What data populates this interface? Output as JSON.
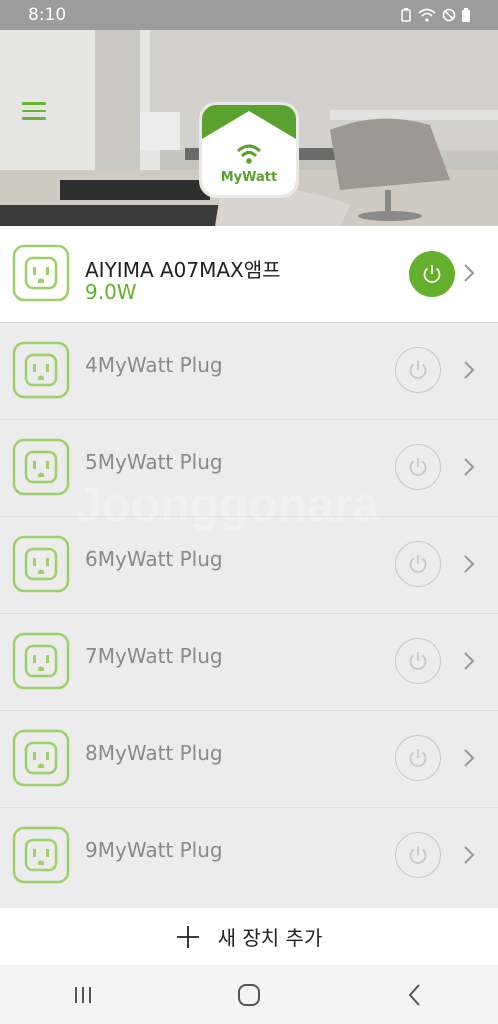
{
  "status_bar": {
    "time": "8:10"
  },
  "app": {
    "logo_text": "MyWatt"
  },
  "devices": [
    {
      "name": "AIYIMA A07MAX앰프",
      "power": "9.0W",
      "on": true
    },
    {
      "name": "4MyWatt Plug",
      "on": false
    },
    {
      "name": "5MyWatt Plug",
      "on": false
    },
    {
      "name": "6MyWatt Plug",
      "on": false
    },
    {
      "name": "7MyWatt Plug",
      "on": false
    },
    {
      "name": "8MyWatt Plug",
      "on": false
    },
    {
      "name": "9MyWatt Plug",
      "on": false
    }
  ],
  "add_device": {
    "label": "새 장치 추가"
  },
  "watermark": "Joonggonara",
  "colors": {
    "accent": "#62b02c",
    "logo_bg": "#5aa12e"
  }
}
